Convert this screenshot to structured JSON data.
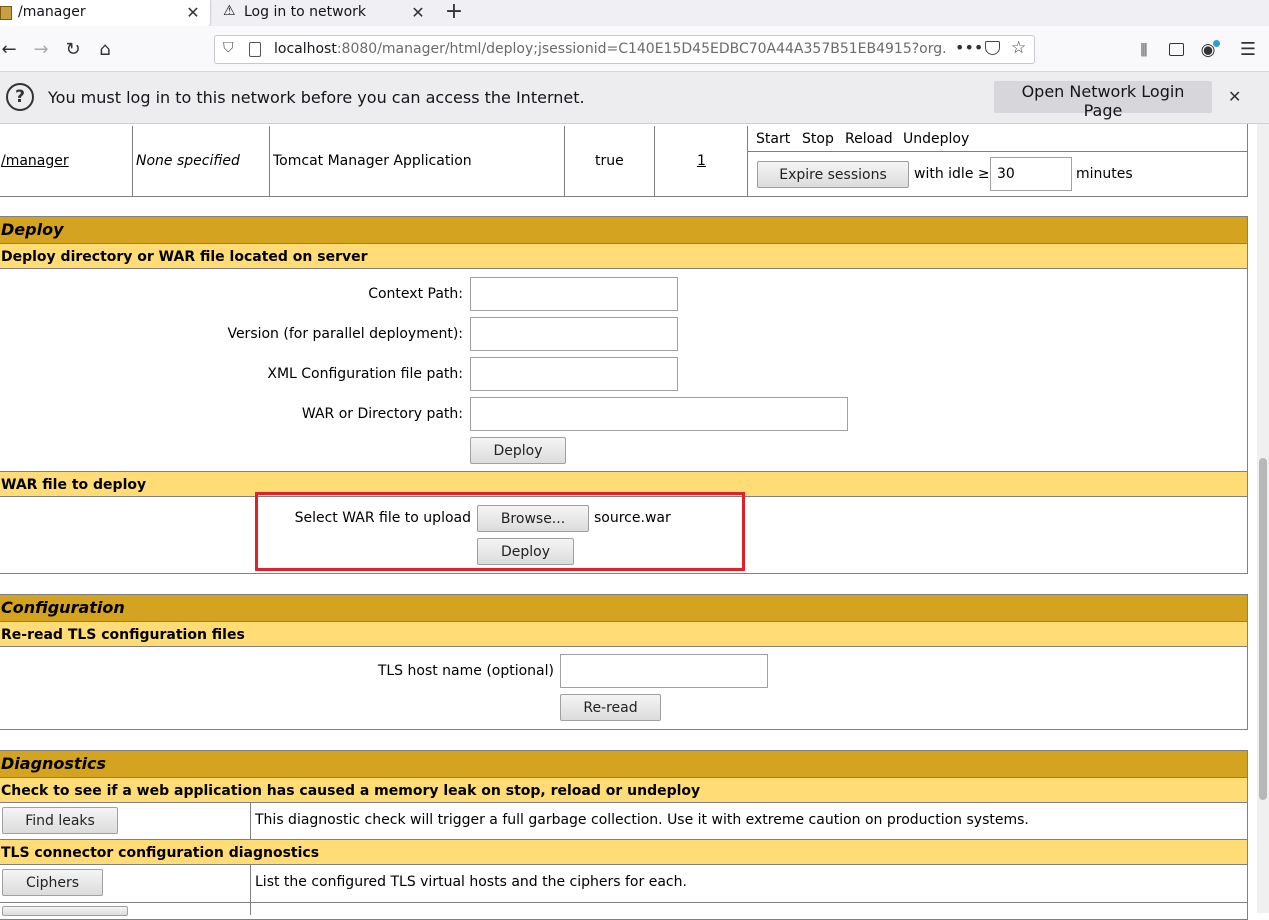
{
  "browser": {
    "tabs": [
      {
        "title": "/manager"
      },
      {
        "title": "Log in to network"
      }
    ],
    "url_host": "localhost",
    "url_rest": ":8080/manager/html/deploy;jsessionid=C140E15D45EDBC70A44A357B51EB4915?org.",
    "notification": {
      "message": "You must log in to this network before you can access the Internet.",
      "button_label": "Open Network Login Page"
    }
  },
  "app_row": {
    "path": "/manager",
    "version": "None specified",
    "display_name": "Tomcat Manager Application",
    "running": "true",
    "sessions": "1",
    "commands": [
      "Start",
      "Stop",
      "Reload",
      "Undeploy"
    ],
    "expire_label": "Expire sessions",
    "with_idle": "with idle ≥",
    "idle_value": "30",
    "minutes": "minutes"
  },
  "deploy": {
    "title": "Deploy",
    "server_section": "Deploy directory or WAR file located on server",
    "context_path_label": "Context Path:",
    "version_label": "Version (for parallel deployment):",
    "xml_label": "XML Configuration file path:",
    "war_label": "WAR or Directory path:",
    "deploy_button": "Deploy",
    "war_section": "WAR file to deploy",
    "select_label": "Select WAR file to upload",
    "browse_button": "Browse...",
    "file_name": "source.war",
    "upload_deploy_button": "Deploy"
  },
  "configuration": {
    "title": "Configuration",
    "tls_section": "Re-read TLS configuration files",
    "tls_host_label": "TLS host name (optional)",
    "reread_button": "Re-read"
  },
  "diagnostics": {
    "title": "Diagnostics",
    "leak_section": "Check to see if a web application has caused a memory leak on stop, reload or undeploy",
    "find_leaks_button": "Find leaks",
    "find_leaks_desc": "This diagnostic check will trigger a full garbage collection. Use it with extreme caution on production systems.",
    "tls_diag_section": "TLS connector configuration diagnostics",
    "ciphers_button": "Ciphers",
    "ciphers_desc": "List the configured TLS virtual hosts and the ciphers for each."
  },
  "colors": {
    "header_dark": "#d4a31f",
    "header_light": "#ffdc75",
    "highlight_box": "#e0202a"
  }
}
